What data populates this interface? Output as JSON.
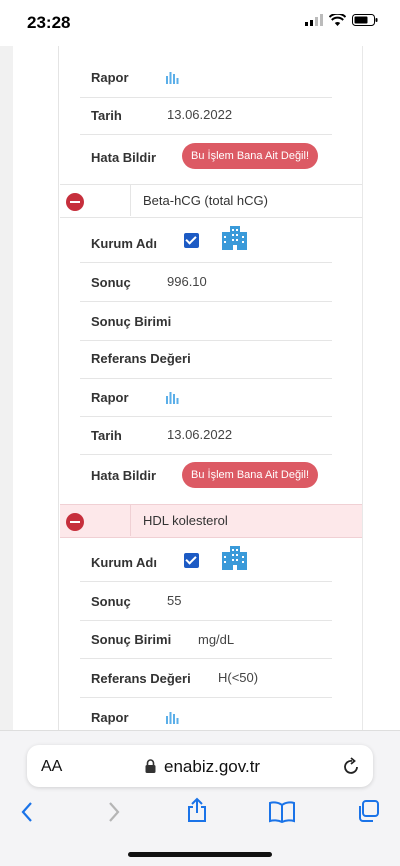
{
  "status_bar": {
    "time": "23:28"
  },
  "labels": {
    "rapor": "Rapor",
    "tarih": "Tarih",
    "hata_bildir": "Hata Bildir",
    "kurum_adi": "Kurum Adı",
    "sonuc": "Sonuç",
    "sonuc_birimi": "Sonuç Birimi",
    "referans_degeri": "Referans Değeri",
    "report_badge": "Bu İşlem Bana Ait Değil!"
  },
  "record_prev": {
    "tarih": "13.06.2022"
  },
  "record_beta": {
    "test_name": "Beta-hCG (total hCG)",
    "sonuc": "996.10",
    "sonuc_birimi": "",
    "referans_degeri": "",
    "tarih": "13.06.2022"
  },
  "record_hdl": {
    "test_name": "HDL kolesterol",
    "sonuc": "55",
    "sonuc_birimi": "mg/dL",
    "referans_degeri": "H(<50)"
  },
  "browser": {
    "text_size_label": "AA",
    "url": "enabiz.gov.tr"
  },
  "icons": {
    "report": "bar-chart-icon",
    "institution": "building-icon",
    "lock": "lock-icon",
    "reload": "reload-icon",
    "back": "back-icon",
    "forward": "forward-icon",
    "share": "share-icon",
    "bookmarks": "book-icon",
    "tabs": "tabs-icon"
  },
  "colors": {
    "badge": "#dc5a64",
    "minus": "#c62f3c",
    "highlight_row": "#fde8ea",
    "checkbox": "#1c5ac4",
    "building": "#3a9ad9",
    "safari_blue": "#1a73e8"
  }
}
